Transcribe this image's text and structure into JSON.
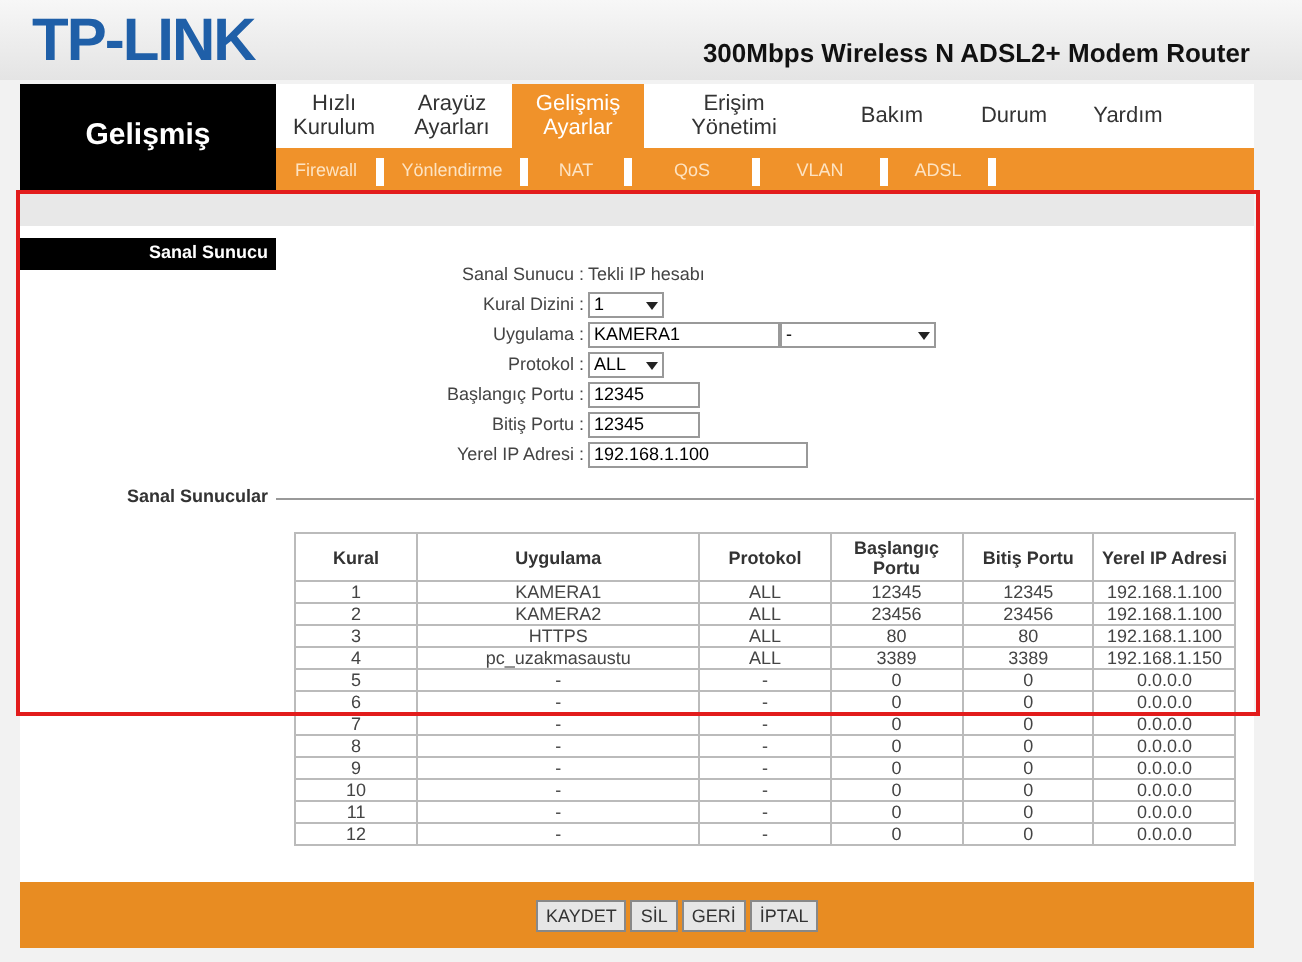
{
  "brand": {
    "logo": "TP-LINK",
    "product": "300Mbps Wireless N ADSL2+ Modem Router"
  },
  "section_title": "Gelişmiş",
  "tabs": [
    {
      "lines": [
        "Hızlı",
        "Kurulum"
      ],
      "selected": false
    },
    {
      "lines": [
        "Arayüz",
        "Ayarları"
      ],
      "selected": false
    },
    {
      "lines": [
        "Gelişmiş",
        "Ayarlar"
      ],
      "selected": true
    },
    {
      "lines": [
        "Erişim",
        "Yönetimi"
      ],
      "selected": false
    },
    {
      "lines": [
        "Bakım"
      ],
      "selected": false
    },
    {
      "lines": [
        "Durum"
      ],
      "selected": false
    },
    {
      "lines": [
        "Yardım"
      ],
      "selected": false
    }
  ],
  "subtabs": [
    "Firewall",
    "Yönlendirme",
    "NAT",
    "QoS",
    "VLAN",
    "ADSL"
  ],
  "sidebar": {
    "items": [
      "Sanal Sunucu",
      "Sanal Sunucular"
    ]
  },
  "form": [
    {
      "label": "Sanal Sunucu :",
      "kind": "static",
      "value": "Tekli IP hesabı"
    },
    {
      "label": "Kural Dizini :",
      "kind": "select",
      "value": "1"
    },
    {
      "label": "Uygulama :",
      "kind": "text_select",
      "value": "KAMERA1",
      "select_value": "-"
    },
    {
      "label": "Protokol :",
      "kind": "select",
      "value": "ALL"
    },
    {
      "label": "Başlangıç Portu :",
      "kind": "text",
      "value": "12345"
    },
    {
      "label": "Bitiş Portu :",
      "kind": "text",
      "value": "12345"
    },
    {
      "label": "Yerel IP Adresi :",
      "kind": "text",
      "value": "192.168.1.100"
    }
  ],
  "table": {
    "columns": [
      "Kural",
      "Uygulama",
      "Protokol",
      "Başlangıç Portu",
      "Bitiş Portu",
      "Yerel IP Adresi"
    ],
    "rows": [
      [
        "1",
        "KAMERA1",
        "ALL",
        "12345",
        "12345",
        "192.168.1.100"
      ],
      [
        "2",
        "KAMERA2",
        "ALL",
        "23456",
        "23456",
        "192.168.1.100"
      ],
      [
        "3",
        "HTTPS",
        "ALL",
        "80",
        "80",
        "192.168.1.100"
      ],
      [
        "4",
        "pc_uzakmasaustu",
        "ALL",
        "3389",
        "3389",
        "192.168.1.150"
      ],
      [
        "5",
        "-",
        "-",
        "0",
        "0",
        "0.0.0.0"
      ],
      [
        "6",
        "-",
        "-",
        "0",
        "0",
        "0.0.0.0"
      ],
      [
        "7",
        "-",
        "-",
        "0",
        "0",
        "0.0.0.0"
      ],
      [
        "8",
        "-",
        "-",
        "0",
        "0",
        "0.0.0.0"
      ],
      [
        "9",
        "-",
        "-",
        "0",
        "0",
        "0.0.0.0"
      ],
      [
        "10",
        "-",
        "-",
        "0",
        "0",
        "0.0.0.0"
      ],
      [
        "11",
        "-",
        "-",
        "0",
        "0",
        "0.0.0.0"
      ],
      [
        "12",
        "-",
        "-",
        "0",
        "0",
        "0.0.0.0"
      ]
    ]
  },
  "buttons": [
    "KAYDET",
    "SİL",
    "GERİ",
    "İPTAL"
  ]
}
